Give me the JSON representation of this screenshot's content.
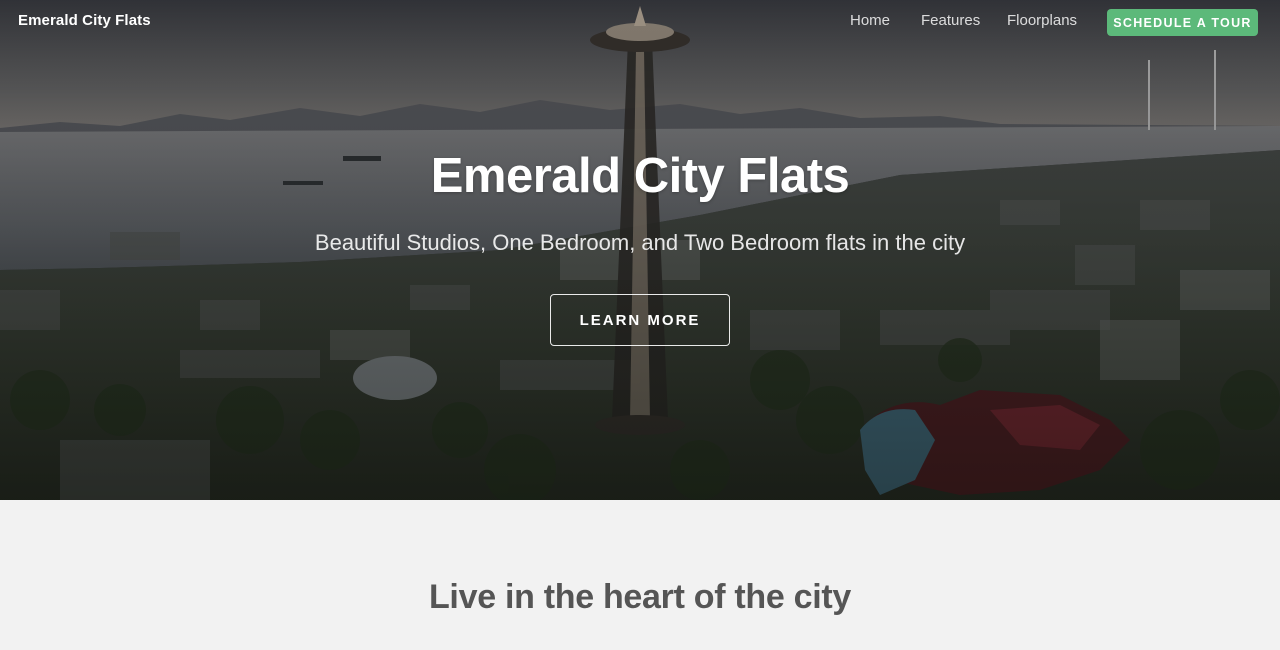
{
  "nav": {
    "brand": "Emerald City Flats",
    "links": [
      "Home",
      "Features",
      "Floorplans"
    ],
    "cta": "Schedule a Tour"
  },
  "hero": {
    "title": "Emerald City Flats",
    "subtitle": "Beautiful Studios, One Bedroom, and Two Bedroom flats in the city",
    "button": "Learn More",
    "image": "seattle-aerial-space-needle-photo"
  },
  "section": {
    "title": "Live in the heart of the city"
  },
  "colors": {
    "accent": "#5cb97a",
    "heading": "#555555",
    "page_bg": "#f2f2f2"
  }
}
